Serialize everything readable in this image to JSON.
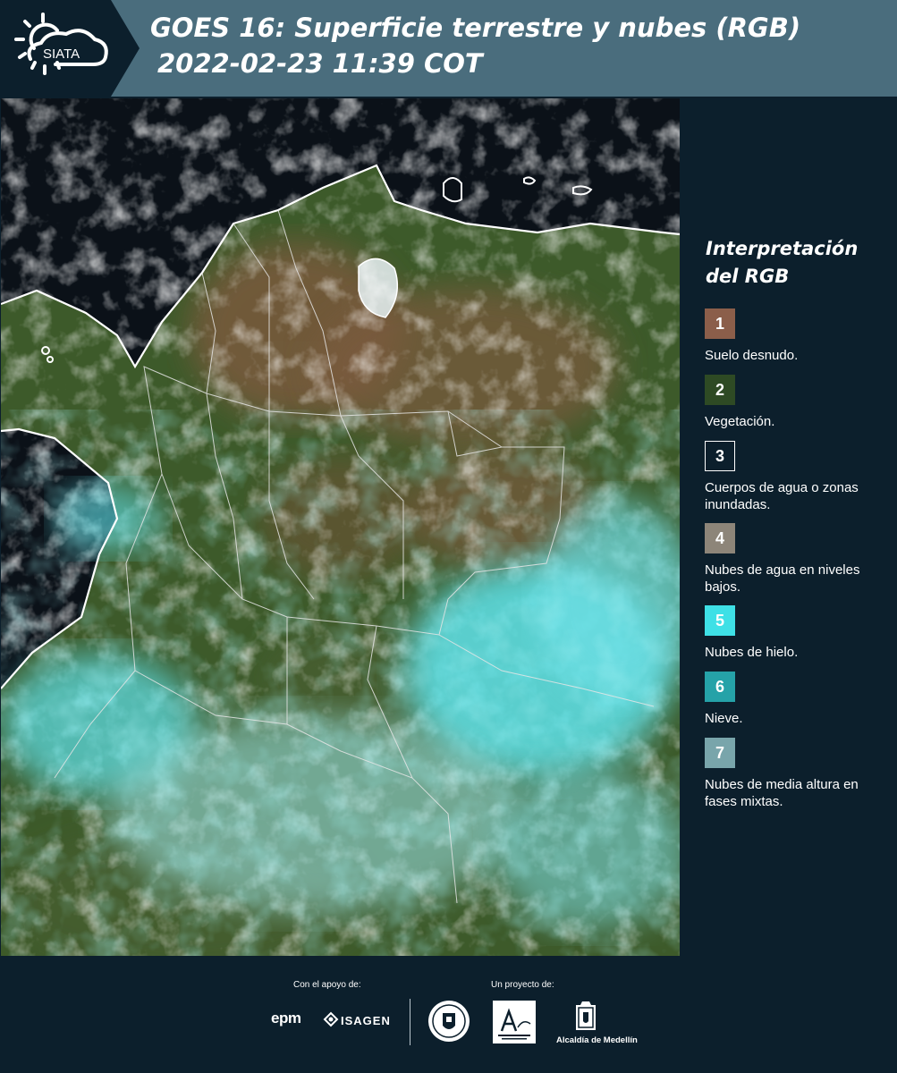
{
  "header": {
    "brand": "SIATA",
    "title_line1": "GOES 16: Superficie terrestre y nubes (RGB)",
    "title_line2": "2022-02-23 11:39 COT"
  },
  "map": {
    "product": "GOES 16 natural color RGB",
    "colors": {
      "land_veg": "#3d5a2a",
      "land_bare": "#7a5a3e",
      "night_sky": "#0b1118",
      "cloud_low": "#e6efee",
      "cloud_ice": "#5fe3ea",
      "coast": "#ffffff"
    }
  },
  "legend": {
    "title": "Interpretación del RGB",
    "items": [
      {
        "number": "1",
        "label": "Suelo desnudo.",
        "color": "#8b5e4a"
      },
      {
        "number": "2",
        "label": "Vegetación.",
        "color": "#2e4a24"
      },
      {
        "number": "3",
        "label": "Cuerpos de agua o zonas inundadas.",
        "color": "#0c1f2c"
      },
      {
        "number": "4",
        "label": "Nubes de agua en niveles bajos.",
        "color": "#8d8579"
      },
      {
        "number": "5",
        "label": "Nubes de hielo.",
        "color": "#3ee0e6"
      },
      {
        "number": "6",
        "label": "Nieve.",
        "color": "#25a2a8"
      },
      {
        "number": "7",
        "label": "Nubes de media altura en fases mixtas.",
        "color": "#79a5ab"
      }
    ]
  },
  "footer": {
    "support_label": "Con el apoyo de:",
    "project_label": "Un proyecto de:",
    "sponsors": [
      "epm",
      "ISAGEN"
    ],
    "alcaldia": "Alcaldía de Medellín"
  }
}
